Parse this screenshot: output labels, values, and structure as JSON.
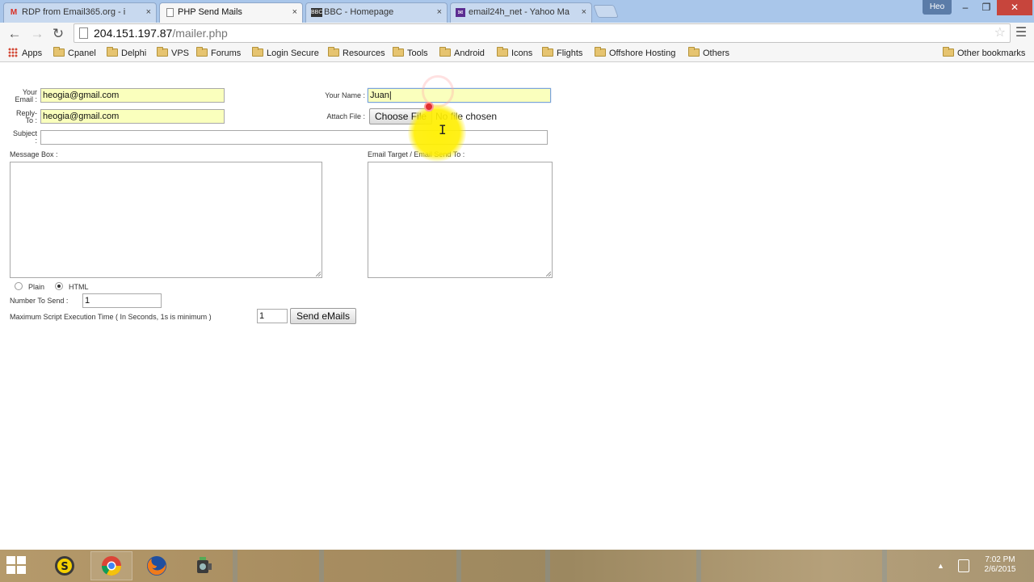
{
  "browser": {
    "tabs": [
      {
        "title": "RDP from Email365.org - i",
        "icon": "gmail-icon",
        "active": false
      },
      {
        "title": "PHP Send Mails",
        "icon": "page-icon",
        "active": true
      },
      {
        "title": "BBC - Homepage",
        "icon": "bbc-icon",
        "active": false
      },
      {
        "title": "email24h_net - Yahoo Ma",
        "icon": "yahoo-mail-icon",
        "active": false
      }
    ],
    "tab_close_glyph": "×",
    "user_badge": "Heo",
    "window_controls": {
      "minimize": "–",
      "maximize": "❐",
      "close": "✕"
    },
    "url_host": "204.151.197.87",
    "url_path": "/mailer.php",
    "bookmarks": [
      "Apps",
      "Cpanel",
      "Delphi",
      "VPS",
      "Forums",
      "Login Secure",
      "Resources",
      "Tools",
      "Android",
      "Icons",
      "Flights",
      "Offshore Hosting",
      "Others"
    ],
    "other_bookmarks": "Other bookmarks"
  },
  "form": {
    "your_email_label_1": "Your",
    "your_email_label_2": "Email :",
    "your_email_value": "heogia@gmail.com",
    "reply_to_label_1": "Reply-",
    "reply_to_label_2": "To :",
    "reply_to_value": "heogia@gmail.com",
    "subject_label_1": "Subject",
    "subject_label_2": ":",
    "subject_value": "",
    "your_name_label": "Your Name :",
    "your_name_value": "Juan",
    "attach_file_label": "Attach File :",
    "choose_file_button": "Choose File",
    "no_file_text": "No file chosen",
    "message_box_label": "Message Box :",
    "email_target_label": "Email Target / Email Send To :",
    "format_plain": "Plain",
    "format_html": "HTML",
    "format_selected": "HTML",
    "number_to_send_label": "Number To Send :",
    "number_to_send_value": "1",
    "max_exec_label": "Maximum Script Execution Time ( In Seconds, 1s is minimum )",
    "max_exec_value": "1",
    "send_button": "Send eMails"
  },
  "taskbar": {
    "time": "7:02 PM",
    "date": "2/6/2015",
    "tray_up_glyph": "▲"
  }
}
